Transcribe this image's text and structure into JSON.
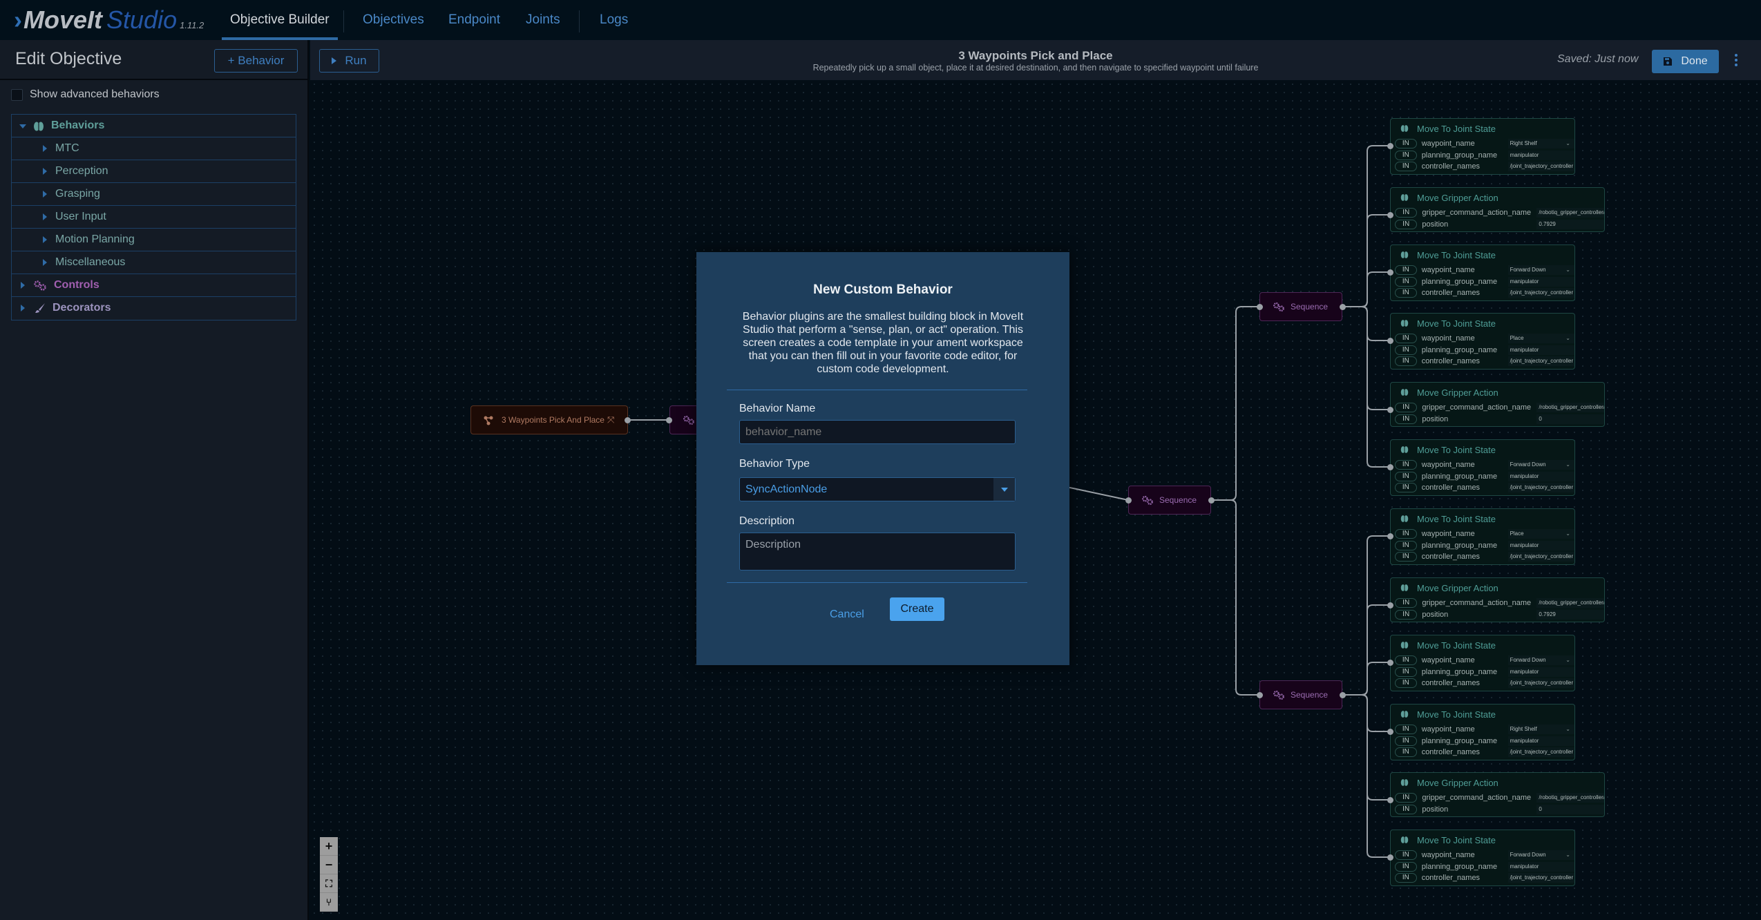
{
  "app": {
    "logo_brand": "MoveIt",
    "logo_product": "Studio",
    "version": "1.11.2"
  },
  "nav": {
    "tabs": [
      {
        "label": "Objective Builder",
        "active": true
      },
      {
        "label": "Objectives",
        "active": false
      },
      {
        "label": "Endpoint",
        "active": false
      },
      {
        "label": "Joints",
        "active": false
      },
      {
        "label": "Logs",
        "active": false
      }
    ]
  },
  "sidebar": {
    "title": "Edit Objective",
    "add_behavior_label": "+  Behavior",
    "show_advanced_label": "Show advanced behaviors",
    "show_advanced_checked": false,
    "tree": [
      {
        "label": "Behaviors",
        "icon": "brain-icon",
        "expanded": true,
        "color": "#5f9f9a"
      },
      {
        "label": "MTC",
        "child": true
      },
      {
        "label": "Perception",
        "child": true
      },
      {
        "label": "Grasping",
        "child": true
      },
      {
        "label": "User Input",
        "child": true
      },
      {
        "label": "Motion Planning",
        "child": true
      },
      {
        "label": "Miscellaneous",
        "child": true
      },
      {
        "label": "Controls",
        "icon": "gears-icon",
        "expanded": false,
        "color": "#a15fb0"
      },
      {
        "label": "Decorators",
        "icon": "brush-icon",
        "expanded": false,
        "color": "#9c93be"
      }
    ]
  },
  "toolbar": {
    "run_label": "Run",
    "objective_title": "3 Waypoints Pick and Place",
    "objective_description": "Repeatedly pick up a small object, place it at desired destination, and then navigate to specified waypoint until failure",
    "saved_status": "Saved: Just now",
    "done_label": "Done"
  },
  "canvas": {
    "root_node": {
      "label": "3 Waypoints Pick And Place"
    },
    "sequence_label": "Sequence",
    "port_tag": "IN",
    "behavior_nodes": [
      {
        "title": "Move To Joint State",
        "ports": [
          [
            "waypoint_name",
            "Right Shelf",
            true
          ],
          [
            "planning_group_name",
            "manipulator",
            false
          ],
          [
            "controller_names",
            "/joint_trajectory_controller /ro",
            false
          ]
        ]
      },
      {
        "title": "Move Gripper Action",
        "ports": [
          [
            "gripper_command_action_name",
            "/robotiq_gripper_controller/gri",
            false
          ],
          [
            "position",
            "0.7929",
            false
          ]
        ]
      },
      {
        "title": "Move To Joint State",
        "ports": [
          [
            "waypoint_name",
            "Forward Down",
            true
          ],
          [
            "planning_group_name",
            "manipulator",
            false
          ],
          [
            "controller_names",
            "/joint_trajectory_controller /ro",
            false
          ]
        ]
      },
      {
        "title": "Move To Joint State",
        "ports": [
          [
            "waypoint_name",
            "Place",
            true
          ],
          [
            "planning_group_name",
            "manipulator",
            false
          ],
          [
            "controller_names",
            "/joint_trajectory_controller /ro",
            false
          ]
        ]
      },
      {
        "title": "Move Gripper Action",
        "ports": [
          [
            "gripper_command_action_name",
            "/robotiq_gripper_controller/gri",
            false
          ],
          [
            "position",
            "0",
            false
          ]
        ]
      },
      {
        "title": "Move To Joint State",
        "ports": [
          [
            "waypoint_name",
            "Forward Down",
            true
          ],
          [
            "planning_group_name",
            "manipulator",
            false
          ],
          [
            "controller_names",
            "/joint_trajectory_controller /ro",
            false
          ]
        ]
      },
      {
        "title": "Move To Joint State",
        "ports": [
          [
            "waypoint_name",
            "Place",
            true
          ],
          [
            "planning_group_name",
            "manipulator",
            false
          ],
          [
            "controller_names",
            "/joint_trajectory_controller /ro",
            false
          ]
        ]
      },
      {
        "title": "Move Gripper Action",
        "ports": [
          [
            "gripper_command_action_name",
            "/robotiq_gripper_controller/gri",
            false
          ],
          [
            "position",
            "0.7929",
            false
          ]
        ]
      },
      {
        "title": "Move To Joint State",
        "ports": [
          [
            "waypoint_name",
            "Forward Down",
            true
          ],
          [
            "planning_group_name",
            "manipulator",
            false
          ],
          [
            "controller_names",
            "/joint_trajectory_controller /ro",
            false
          ]
        ]
      },
      {
        "title": "Move To Joint State",
        "ports": [
          [
            "waypoint_name",
            "Right Shelf",
            true
          ],
          [
            "planning_group_name",
            "manipulator",
            false
          ],
          [
            "controller_names",
            "/joint_trajectory_controller /ro",
            false
          ]
        ]
      },
      {
        "title": "Move Gripper Action",
        "ports": [
          [
            "gripper_command_action_name",
            "/robotiq_gripper_controller/gri",
            false
          ],
          [
            "position",
            "0",
            false
          ]
        ]
      },
      {
        "title": "Move To Joint State",
        "ports": [
          [
            "waypoint_name",
            "Forward Down",
            true
          ],
          [
            "planning_group_name",
            "manipulator",
            false
          ],
          [
            "controller_names",
            "/joint_trajectory_controller /ro",
            false
          ]
        ]
      }
    ],
    "zoom_controls": [
      "+",
      "−",
      "⛶",
      "⑂"
    ]
  },
  "modal": {
    "title": "New Custom Behavior",
    "description": "Behavior plugins are the smallest building block in MoveIt Studio that perform a \"sense, plan, or act\" operation. This screen creates a code template in your ament workspace that you can then fill out in your favorite code editor, for custom code development.",
    "name_label": "Behavior Name",
    "name_placeholder": "behavior_name",
    "name_value": "",
    "type_label": "Behavior Type",
    "type_value": "SyncActionNode",
    "description_label": "Description",
    "description_placeholder": "Description",
    "cancel_label": "Cancel",
    "create_label": "Create"
  },
  "colors": {
    "accent": "#2c6aa1",
    "create_button": "#4aa3ee",
    "modal_bg": "#1e3e5c",
    "behavior_node": "#1e4744",
    "control_node": "#4d2656",
    "root_node": "#5a3220"
  }
}
